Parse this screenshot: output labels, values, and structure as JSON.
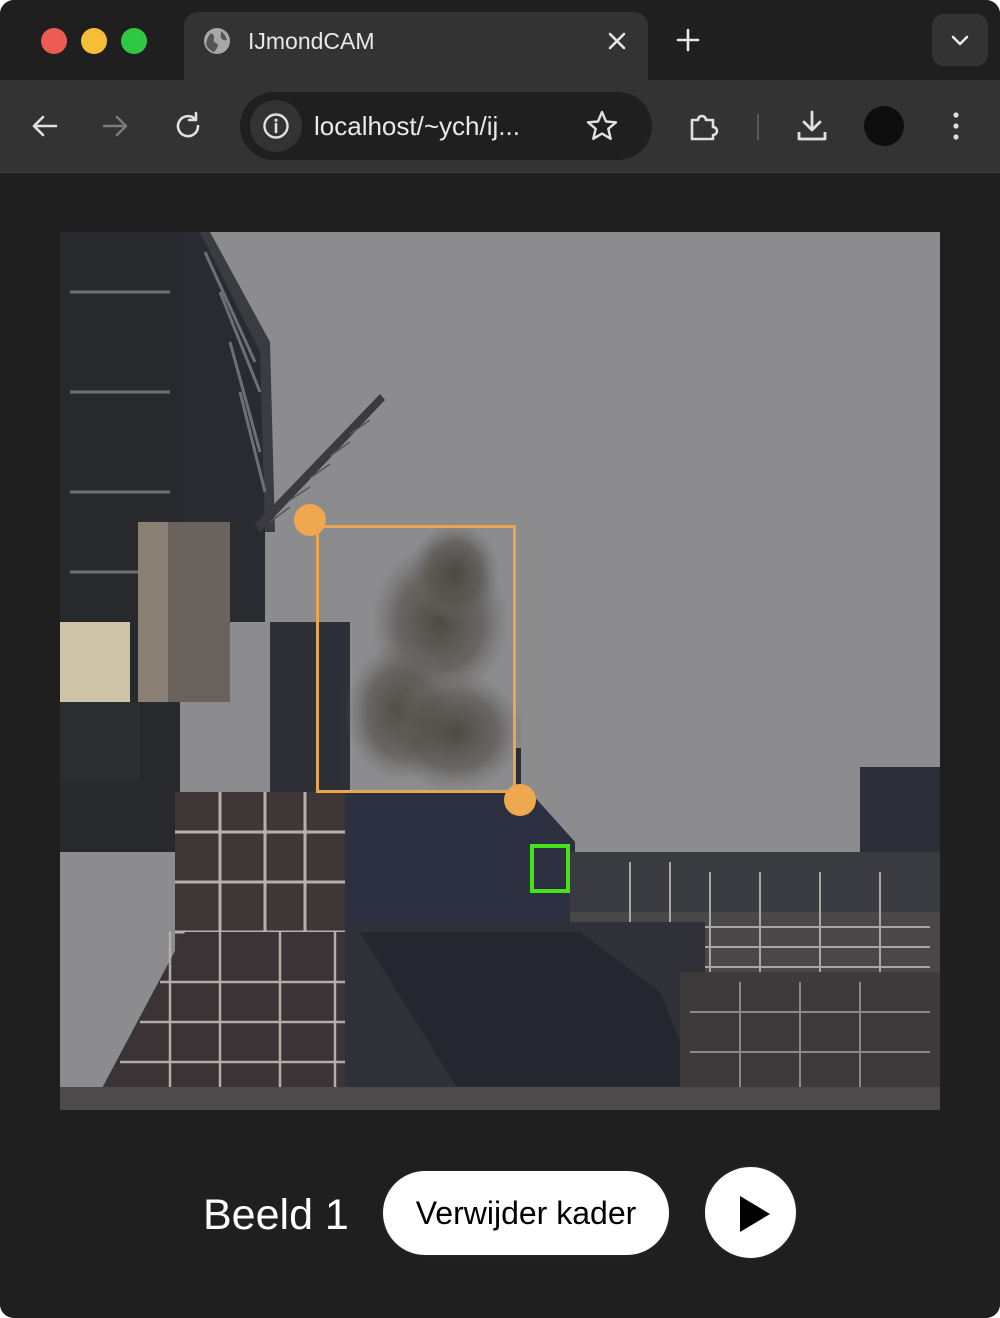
{
  "browser": {
    "tab": {
      "title": "IJmondCAM"
    },
    "address_bar": {
      "url": "localhost/~ych/ij..."
    }
  },
  "viewer": {
    "frame_label": "Beeld 1",
    "remove_button_label": "Verwijder kader"
  },
  "colors": {
    "bbox": "#e8a552",
    "handle": "#efa850",
    "green_marker": "#46e21b"
  }
}
